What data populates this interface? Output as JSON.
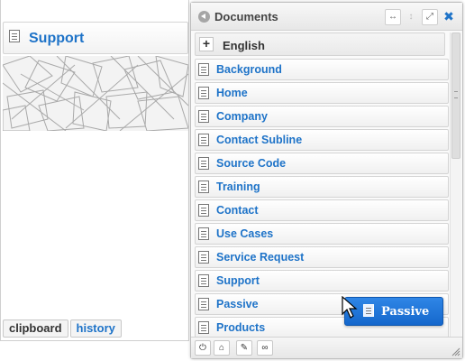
{
  "left_panel": {
    "title": "Support",
    "tabs": [
      "clipboard",
      "history"
    ]
  },
  "dialog": {
    "title": "Documents",
    "language": "English",
    "items": [
      "Background",
      "Home",
      "Company",
      "Contact Subline",
      "Source Code",
      "Training",
      "Contact",
      "Use Cases",
      "Service Request",
      "Support",
      "Passive",
      "Products"
    ]
  },
  "drag_proxy": {
    "label": "Passive"
  },
  "colors": {
    "link": "#1e73c8",
    "drag_bg": "#1f77da"
  }
}
